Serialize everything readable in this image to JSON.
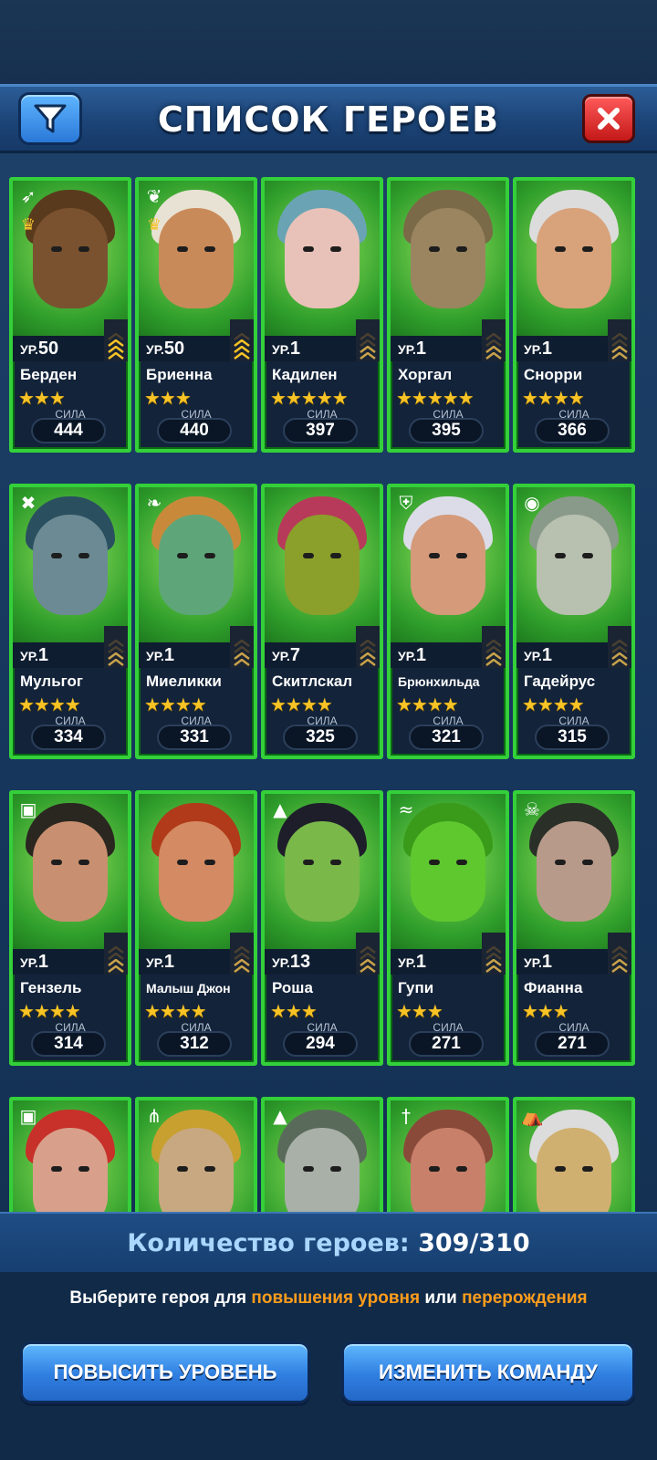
{
  "header": {
    "title": "СПИСОК ГЕРОЕВ",
    "filter_icon": "funnel-icon",
    "close_icon": "close-x-icon"
  },
  "level_prefix": "УР.",
  "power_label": "СИЛА",
  "heroes": [
    {
      "name": "Берден",
      "level": "50",
      "stars": "★★★",
      "power": "444",
      "class_icon": "bow-icon",
      "portrait_color": "#7a5230",
      "hair_color": "#5a3a1c"
    },
    {
      "name": "Бриенна",
      "level": "50",
      "stars": "★★★",
      "power": "440",
      "class_icon": "leaf-icon",
      "portrait_color": "#c98a5a",
      "hair_color": "#e8e2d4"
    },
    {
      "name": "Кадилен",
      "level": "1",
      "stars": "★★★★★",
      "power": "397",
      "class_icon": "",
      "portrait_color": "#e8c2b8",
      "hair_color": "#6aa4b4"
    },
    {
      "name": "Хоргал",
      "level": "1",
      "stars": "★★★★★",
      "power": "395",
      "class_icon": "",
      "portrait_color": "#9a8560",
      "hair_color": "#7a6a48"
    },
    {
      "name": "Снорри",
      "level": "1",
      "stars": "★★★★",
      "power": "366",
      "class_icon": "",
      "portrait_color": "#d8a27a",
      "hair_color": "#dcdcdc"
    },
    {
      "name": "Мульгог",
      "level": "1",
      "stars": "★★★★",
      "power": "334",
      "class_icon": "cross-icon",
      "portrait_color": "#6c8a94",
      "hair_color": "#2a5060"
    },
    {
      "name": "Миеликки",
      "level": "1",
      "stars": "★★★★",
      "power": "331",
      "class_icon": "feather-icon",
      "portrait_color": "#5ea67a",
      "hair_color": "#c88a3a"
    },
    {
      "name": "Скитлскал",
      "level": "7",
      "stars": "★★★★",
      "power": "325",
      "class_icon": "",
      "portrait_color": "#8aa02a",
      "hair_color": "#b83a5a"
    },
    {
      "name": "Брюнхильда",
      "level": "1",
      "stars": "★★★★",
      "power": "321",
      "class_icon": "shield-icon",
      "portrait_color": "#d49a7a",
      "hair_color": "#dcdce8"
    },
    {
      "name": "Гадейрус",
      "level": "1",
      "stars": "★★★★",
      "power": "315",
      "class_icon": "orb-icon",
      "portrait_color": "#b8c0b0",
      "hair_color": "#8a9a8a"
    },
    {
      "name": "Гензель",
      "level": "1",
      "stars": "★★★★",
      "power": "314",
      "class_icon": "spellbook-icon",
      "portrait_color": "#c89070",
      "hair_color": "#2a2620"
    },
    {
      "name": "Малыш Джон",
      "level": "1",
      "stars": "★★★★",
      "power": "312",
      "class_icon": "",
      "portrait_color": "#d48a62",
      "hair_color": "#b03a1a"
    },
    {
      "name": "Роша",
      "level": "13",
      "stars": "★★★",
      "power": "294",
      "class_icon": "wizard-hat-icon",
      "portrait_color": "#7ab84a",
      "hair_color": "#1e1e2a"
    },
    {
      "name": "Гупи",
      "level": "1",
      "stars": "★★★",
      "power": "271",
      "class_icon": "bat-icon",
      "portrait_color": "#5ec82e",
      "hair_color": "#3a9a1a"
    },
    {
      "name": "Фианна",
      "level": "1",
      "stars": "★★★",
      "power": "271",
      "class_icon": "skull-icon",
      "portrait_color": "#b89a8a",
      "hair_color": "#2a3028"
    }
  ],
  "partial_heroes": [
    {
      "portrait_color": "#d8a08a",
      "hair_color": "#c8302a",
      "class_icon": "spellbook-icon"
    },
    {
      "portrait_color": "#c8a880",
      "hair_color": "#c8a030",
      "class_icon": "claw-icon"
    },
    {
      "portrait_color": "#a8b0a8",
      "hair_color": "#5a6a5a",
      "class_icon": "wizard-hat-icon"
    },
    {
      "portrait_color": "#c8806a",
      "hair_color": "#8a4a3a",
      "class_icon": "sword-icon"
    },
    {
      "portrait_color": "#d0b070",
      "hair_color": "#dcdcdc",
      "class_icon": "tent-icon"
    }
  ],
  "footer": {
    "count_label": "Количество героев:",
    "count_value": "309/310",
    "hint_1": "Выберите героя для ",
    "hint_2": "повышения уровня",
    "hint_3": " или ",
    "hint_4": "перерождения",
    "level_up_label": "ПОВЫСИТЬ УРОВЕНЬ",
    "change_team_label": "ИЗМЕНИТЬ КОМАНДУ"
  }
}
